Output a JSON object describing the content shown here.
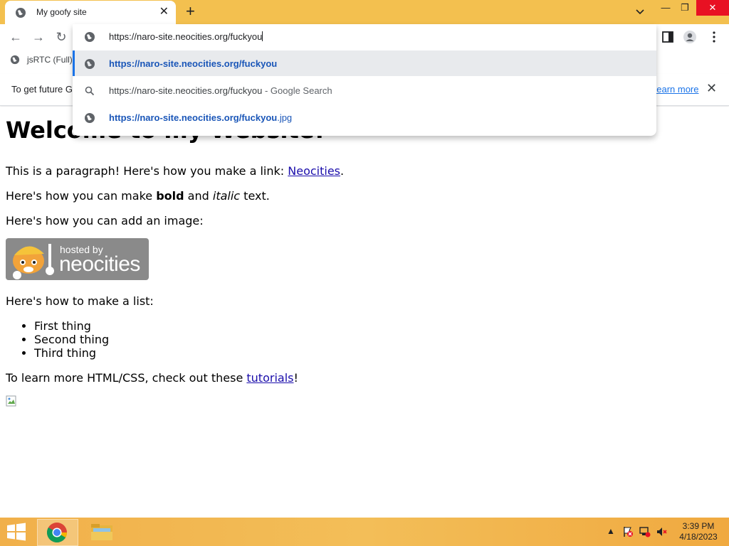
{
  "tab": {
    "title": "My goofy site",
    "close": "✕"
  },
  "window": {
    "new_tab": "+",
    "minimize": "—",
    "restore": "❐",
    "close": "✕"
  },
  "toolbar": {
    "back": "←",
    "forward": "→",
    "reload": "↻"
  },
  "omnibox": {
    "input_value": "https://naro-site.neocities.org/fuckyou",
    "suggestions": [
      {
        "main": "https://naro-site.neocities.org/fuckyou",
        "suffix": ""
      },
      {
        "main": "https://naro-site.neocities.org/fuckyou",
        "suffix": " - Google Search"
      },
      {
        "main": "https://naro-site.neocities.org/fuckyou",
        "suffix": ".jpg"
      }
    ]
  },
  "bookmarks": [
    {
      "label": "jsRTC (Full)"
    }
  ],
  "infobar": {
    "message": "To get future G",
    "learn_more": "Learn more",
    "close": "✕"
  },
  "page": {
    "heading": "Welcome to my Website!",
    "p1_text": "This is a paragraph! Here's how you make a link: ",
    "p1_link": "Neocities",
    "p1_end": ".",
    "p2_a": "Here's how you can make ",
    "p2_bold": "bold",
    "p2_b": " and ",
    "p2_italic": "italic",
    "p2_c": " text.",
    "p3": "Here's how you can add an image:",
    "badge_hosted": "hosted by",
    "badge_brand": "neocities",
    "p4": "Here's how to make a list:",
    "list": [
      "First thing",
      "Second thing",
      "Third thing"
    ],
    "p5_text": "To learn more HTML/CSS, check out these ",
    "p5_link": "tutorials",
    "p5_end": "!"
  },
  "taskbar": {
    "time": "3:39 PM",
    "date": "4/18/2023"
  },
  "colors": {
    "accent": "#f3c04f",
    "link": "#1a0dab",
    "suggestion_link": "#1a56b8"
  }
}
